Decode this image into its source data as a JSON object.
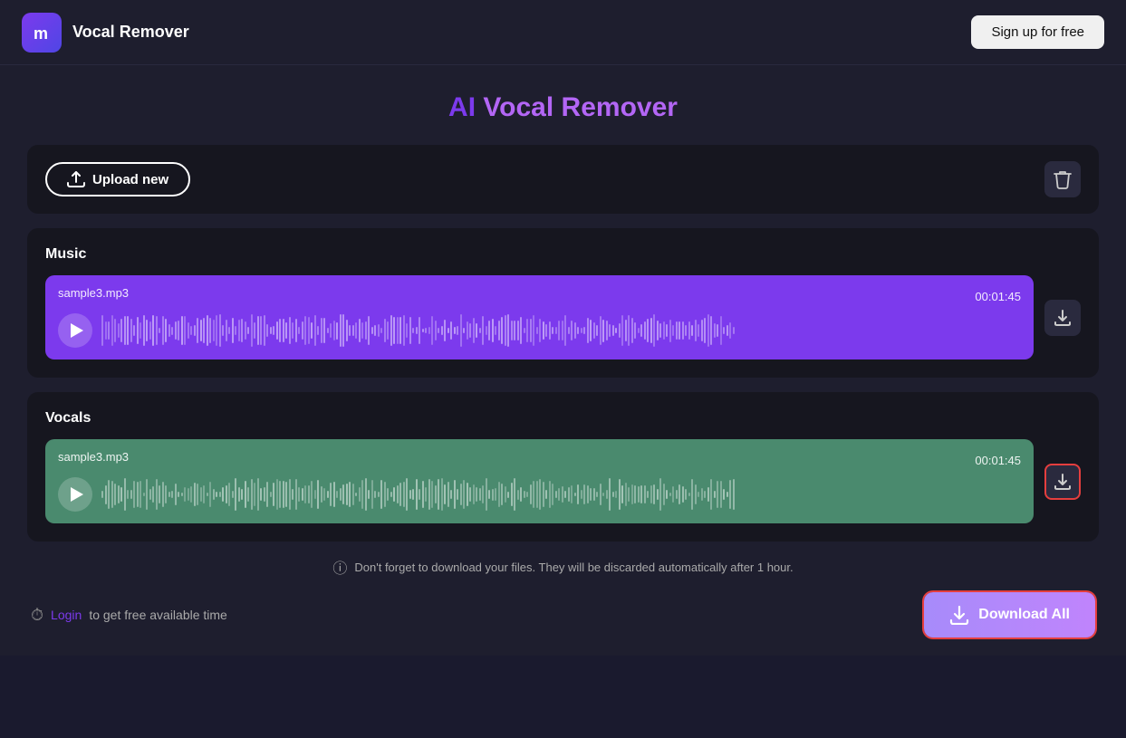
{
  "header": {
    "logo_letter": "m",
    "app_title": "Vocal Remover",
    "signup_label": "Sign up for free"
  },
  "page": {
    "title_ai": "AI",
    "title_vocal": " Vocal",
    "title_remover": " Remover"
  },
  "upload_bar": {
    "upload_label": "Upload new",
    "delete_tooltip": "Delete"
  },
  "music_section": {
    "label": "Music",
    "filename": "sample3.mp3",
    "duration": "00:01:45"
  },
  "vocals_section": {
    "label": "Vocals",
    "filename": "sample3.mp3",
    "duration": "00:01:45"
  },
  "footer": {
    "info_text": "Don't forget to download your files. They will be discarded automatically after 1 hour.",
    "login_prompt": "Login",
    "login_suffix": " to get free available time",
    "download_all_label": "Download All"
  }
}
